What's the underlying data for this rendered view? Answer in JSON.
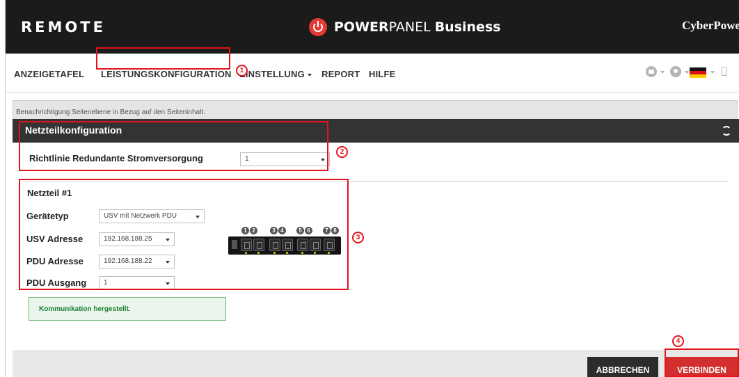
{
  "header": {
    "remote_label": "REMOTE",
    "brand_power": "POWER",
    "brand_panel": "PANEL",
    "brand_business": "Business",
    "vendor": "CyberPowe"
  },
  "nav": {
    "items": [
      {
        "label": "ANZEIGETAFEL"
      },
      {
        "label": "LEISTUNGSKONFIGURATION"
      },
      {
        "label": "EINSTELLUNG"
      },
      {
        "label": "REPORT"
      },
      {
        "label": "HILFE"
      }
    ]
  },
  "notification": "Benachrichtigung Seitenebene in Bezug auf den Seiteninhalt.",
  "panel": {
    "title": "Netzteilkonfiguration",
    "redundancy_label": "Richtlinie Redundante Stromversorgung",
    "redundancy_value": "1",
    "psu_title": "Netzteil #1",
    "device_type_label": "Gerätetyp",
    "device_type_value": "USV mit Netzwerk PDU",
    "ups_address_label": "USV Adresse",
    "ups_address_value": "192.168.188.25",
    "pdu_address_label": "PDU Adresse",
    "pdu_address_value": "192.168.188.22",
    "pdu_outlet_label": "PDU Ausgang",
    "pdu_outlet_value": "1",
    "outlet_numbers": [
      "1",
      "2",
      "3",
      "4",
      "5",
      "6",
      "7",
      "8"
    ],
    "status_message": "Kommunikation hergestellt."
  },
  "footer": {
    "cancel_label": "ABBRECHEN",
    "connect_label": "VERBINDEN"
  },
  "annotations": [
    "1",
    "2",
    "3",
    "4"
  ],
  "colors": {
    "header_bg": "#1b1b1b",
    "accent_red": "#d32f2f",
    "annotation_red": "#e3131b",
    "status_green": "#1e7c34"
  }
}
